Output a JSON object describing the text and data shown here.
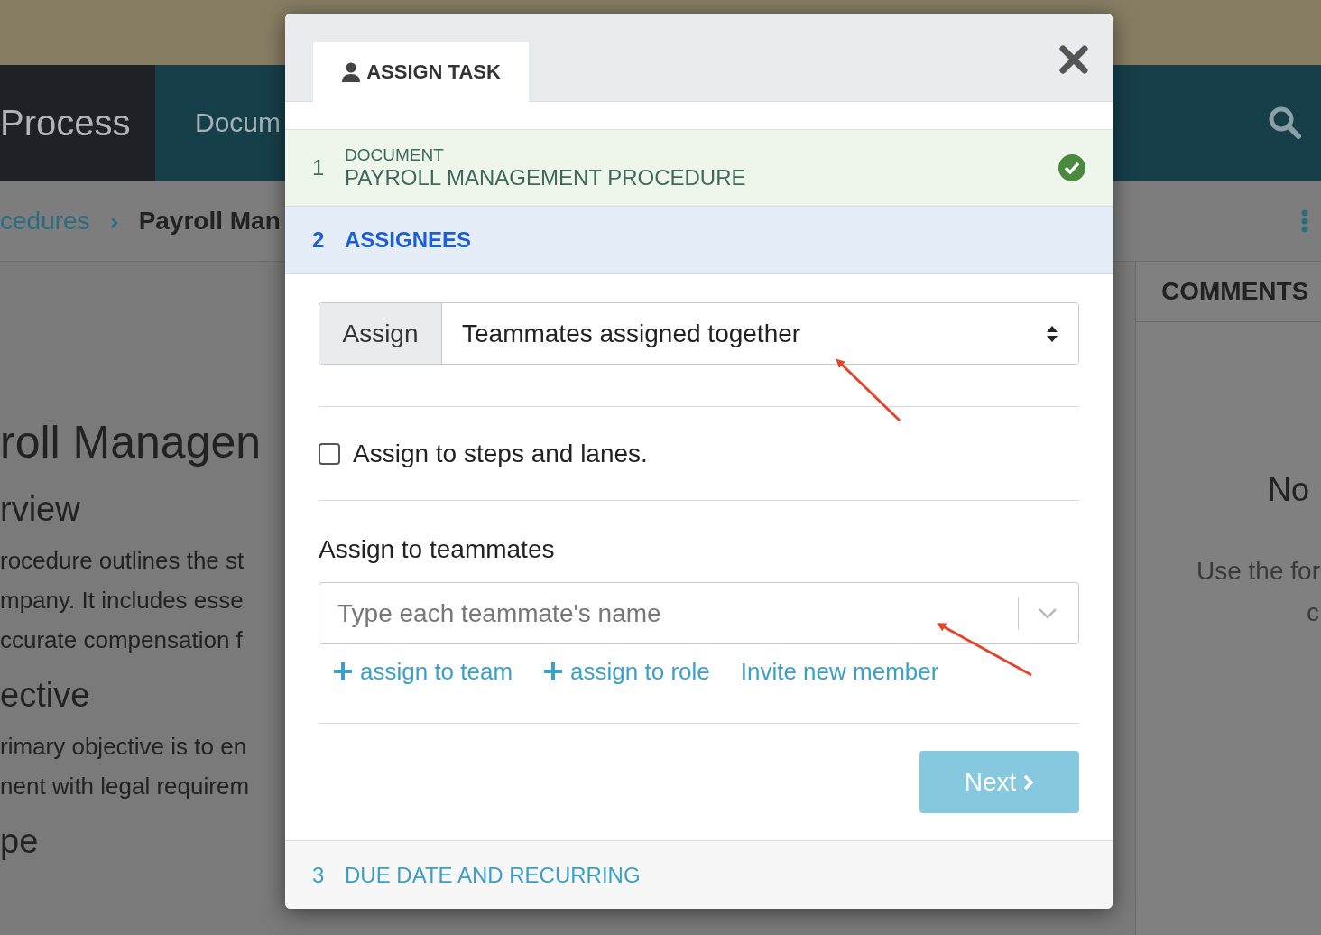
{
  "background": {
    "logo": "Process",
    "nav_item": "Docum",
    "breadcrumb": [
      {
        "label": "cedures",
        "kind": "link"
      },
      {
        "label": "Payroll Man",
        "kind": "current"
      }
    ],
    "title": "roll Managen",
    "sections": [
      {
        "heading": "rview",
        "lines": [
          "rocedure outlines the st",
          "mpany. It includes esse",
          "ccurate compensation f"
        ]
      },
      {
        "heading": "ective",
        "lines": [
          "rimary objective is to en",
          "nent with legal requirem"
        ]
      },
      {
        "heading": "pe"
      }
    ],
    "comments": {
      "title": "COMMENTS",
      "empty_title": "No",
      "empty_lines": [
        "Use the for",
        "c"
      ]
    }
  },
  "dialog": {
    "tab": {
      "label": "ASSIGN TASK",
      "selected": true
    },
    "steps": [
      {
        "number": "1",
        "label": "DOCUMENT",
        "value": "PAYROLL MANAGEMENT PROCEDURE",
        "completed": true,
        "selected": false
      },
      {
        "number": "2",
        "label": "ASSIGNEES",
        "completed": false,
        "selected": true
      },
      {
        "number": "3",
        "label": "DUE DATE AND RECURRING",
        "completed": false,
        "selected": false
      }
    ],
    "assign_mode": {
      "addon": "Assign",
      "value": "Teammates assigned together"
    },
    "steps_checkbox": {
      "label": "Assign to steps and lanes.",
      "checked": false
    },
    "teammates": {
      "label": "Assign to teammates",
      "placeholder": "Type each teammate's name"
    },
    "links": [
      {
        "kind": "add",
        "label": "assign to team"
      },
      {
        "kind": "add",
        "label": "assign to role"
      },
      {
        "kind": "plain",
        "label": "Invite new member"
      }
    ],
    "next_button": {
      "label": "Next",
      "disabled": true
    }
  }
}
